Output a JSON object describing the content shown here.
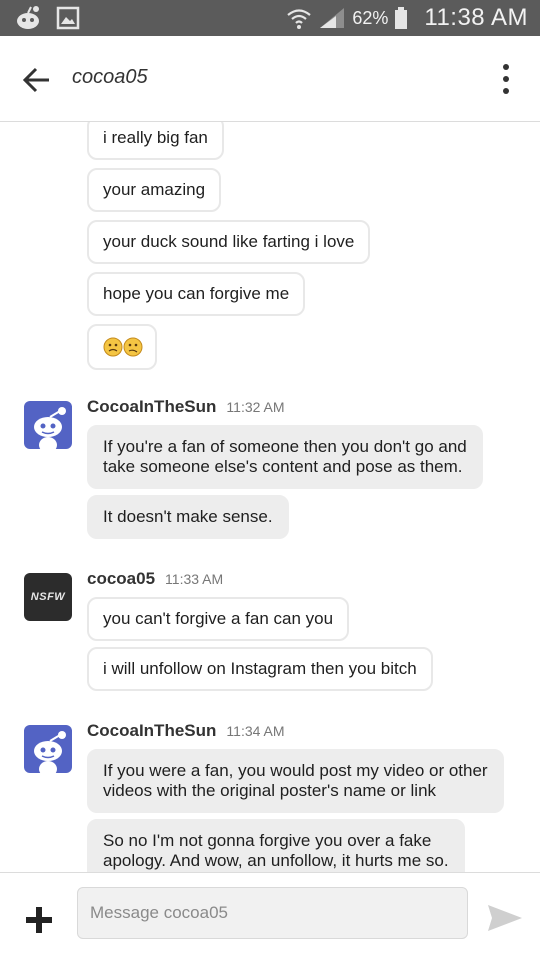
{
  "status_bar": {
    "battery": "62%",
    "time": "11:38 AM"
  },
  "header": {
    "title": "cocoa05"
  },
  "messages_top": [
    "i really big fan",
    "your amazing",
    "your duck sound like farting i love",
    "hope you can forgive me"
  ],
  "groups": [
    {
      "user": "CocoaInTheSun",
      "time": "11:32 AM",
      "messages": [
        "If you're a fan of someone then you don't go and",
        "take someone else's content and pose as them.",
        "It doesn't make sense."
      ]
    },
    {
      "user": "cocoa05",
      "avatar_text": "NSFW",
      "time": "11:33 AM",
      "messages": [
        "you can't forgive a fan can you",
        "i will unfollow on Instagram then you bitch"
      ]
    },
    {
      "user": "CocoaInTheSun",
      "time": "11:34 AM",
      "messages": [
        "If you were a fan, you would post my video or other",
        "videos with the original poster's name or link",
        "So no I'm not gonna forgive you over a fake",
        "apology. And wow, an unfollow, it hurts me so."
      ]
    }
  ],
  "composer": {
    "placeholder": "Message cocoa05"
  },
  "colors": {
    "status_bar": "#5b5b5b",
    "reddit_avatar": "#5363c4",
    "incoming_bubble": "#ededed"
  }
}
